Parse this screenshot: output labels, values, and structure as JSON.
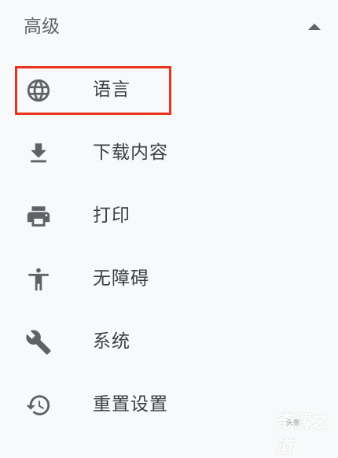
{
  "section": {
    "title": "高级",
    "collapse_icon": "caret-up-icon"
  },
  "items": [
    {
      "label": "语言",
      "icon": "globe-icon"
    },
    {
      "label": "下载内容",
      "icon": "download-icon"
    },
    {
      "label": "打印",
      "icon": "printer-icon"
    },
    {
      "label": "无障碍",
      "icon": "accessibility-icon"
    },
    {
      "label": "系统",
      "icon": "wrench-icon"
    },
    {
      "label": "重置设置",
      "icon": "history-icon"
    }
  ],
  "highlight": {
    "color": "#e8341c",
    "target": "语言"
  },
  "watermark": {
    "text": "奇偶之道",
    "subtext": "头条"
  }
}
